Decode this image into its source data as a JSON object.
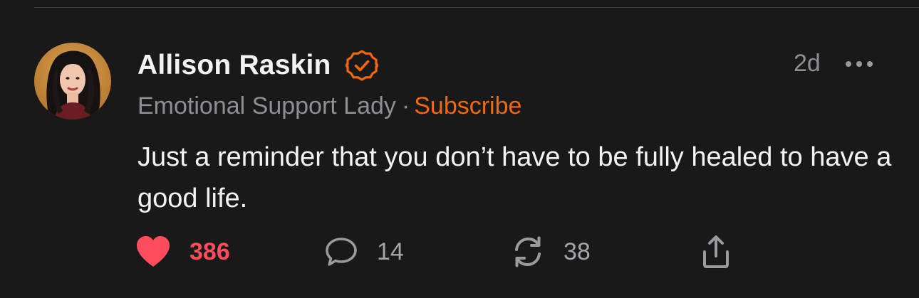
{
  "post": {
    "author": {
      "name": "Allison Raskin",
      "publication": "Emotional Support Lady",
      "separator": "·",
      "subscribe_label": "Subscribe"
    },
    "timestamp": "2d",
    "body": "Just a reminder that you don’t have to be fully healed to have a good life.",
    "actions": {
      "likes": "386",
      "comments": "14",
      "restacks": "38"
    }
  },
  "icons": {
    "verified": "verified-badge-icon",
    "more": "more-icon",
    "like": "heart-icon",
    "comment": "comment-icon",
    "restack": "restack-icon",
    "share": "share-icon"
  },
  "colors": {
    "background": "#19191a",
    "accent": "#f4680b",
    "like": "#ff4d5e",
    "muted": "#8e8e93"
  }
}
